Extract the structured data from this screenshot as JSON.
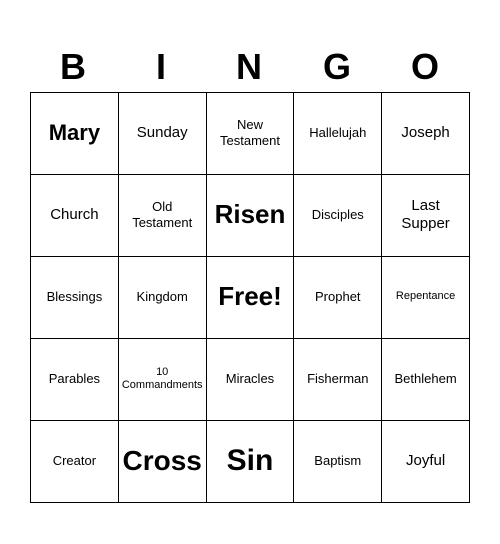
{
  "header": {
    "letters": [
      "B",
      "I",
      "N",
      "G",
      "O"
    ]
  },
  "cells": [
    {
      "text": "Mary",
      "size": "large"
    },
    {
      "text": "Sunday",
      "size": "medium"
    },
    {
      "text": "New\nTestament",
      "size": "small"
    },
    {
      "text": "Hallelujah",
      "size": "small"
    },
    {
      "text": "Joseph",
      "size": "medium"
    },
    {
      "text": "Church",
      "size": "medium"
    },
    {
      "text": "Old\nTestament",
      "size": "small"
    },
    {
      "text": "Risen",
      "size": "risen"
    },
    {
      "text": "Disciples",
      "size": "small"
    },
    {
      "text": "Last\nSupper",
      "size": "medium"
    },
    {
      "text": "Blessings",
      "size": "small"
    },
    {
      "text": "Kingdom",
      "size": "small"
    },
    {
      "text": "Free!",
      "size": "free"
    },
    {
      "text": "Prophet",
      "size": "small"
    },
    {
      "text": "Repentance",
      "size": "xsmall"
    },
    {
      "text": "Parables",
      "size": "small"
    },
    {
      "text": "10\nCommandments",
      "size": "xsmall"
    },
    {
      "text": "Miracles",
      "size": "small"
    },
    {
      "text": "Fisherman",
      "size": "small"
    },
    {
      "text": "Bethlehem",
      "size": "small"
    },
    {
      "text": "Creator",
      "size": "small"
    },
    {
      "text": "Cross",
      "size": "cross"
    },
    {
      "text": "Sin",
      "size": "sin"
    },
    {
      "text": "Baptism",
      "size": "small"
    },
    {
      "text": "Joyful",
      "size": "medium"
    }
  ]
}
